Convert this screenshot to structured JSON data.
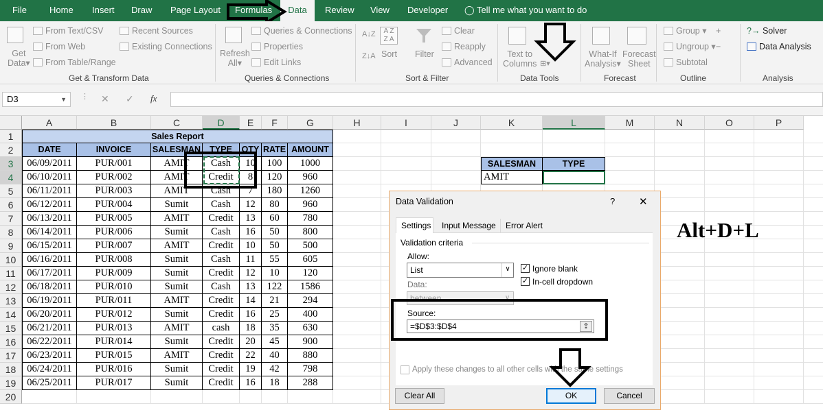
{
  "menu": {
    "tabs": [
      "File",
      "Home",
      "Insert",
      "Draw",
      "Page Layout",
      "Formulas",
      "Data",
      "Review",
      "View",
      "Developer"
    ],
    "active": "Data",
    "tell_me": "Tell me what you want to do"
  },
  "ribbon": {
    "get_data": [
      "Get",
      "Data"
    ],
    "from_text": "From Text/CSV",
    "from_web": "From Web",
    "from_table": "From Table/Range",
    "recent_sources": "Recent Sources",
    "existing_connections": "Existing Connections",
    "group_get_transform": "Get & Transform Data",
    "refresh_all": [
      "Refresh",
      "All"
    ],
    "queries_connections": "Queries & Connections",
    "properties": "Properties",
    "edit_links": "Edit Links",
    "group_queries": "Queries & Connections",
    "sort": "Sort",
    "filter": "Filter",
    "clear": "Clear",
    "reapply": "Reapply",
    "advanced": "Advanced",
    "group_sort_filter": "Sort & Filter",
    "text_to_columns": [
      "Text to",
      "Columns"
    ],
    "group_data_tools": "Data Tools",
    "what_if": [
      "What-If",
      "Analysis"
    ],
    "forecast_sheet": [
      "Forecast",
      "Sheet"
    ],
    "group_forecast": "Forecast",
    "group_btn": "Group",
    "ungroup": "Ungroup",
    "subtotal": "Subtotal",
    "group_outline": "Outline",
    "solver": "Solver",
    "data_analysis": "Data Analysis",
    "group_analysis": "Analysis"
  },
  "formula_bar": {
    "name_box": "D3",
    "fx": "fx",
    "cancel": "✕",
    "enter": "✓"
  },
  "sheet": {
    "columns": [
      "A",
      "B",
      "C",
      "D",
      "E",
      "F",
      "G",
      "H",
      "I",
      "J",
      "K",
      "L",
      "M",
      "N",
      "O",
      "P"
    ],
    "rows": [
      "1",
      "2",
      "3",
      "4",
      "5",
      "6",
      "7",
      "8",
      "9",
      "10",
      "11",
      "12",
      "13",
      "14",
      "15",
      "16",
      "17",
      "18",
      "19",
      "20"
    ],
    "title": "Sales Report",
    "headers": [
      "DATE",
      "INVOICE",
      "SALESMAN",
      "TYPE",
      "QTY",
      "RATE",
      "AMOUNT"
    ],
    "data": [
      [
        "06/09/2011",
        "PUR/001",
        "AMIT",
        "Cash",
        "10",
        "100",
        "1000"
      ],
      [
        "06/10/2011",
        "PUR/002",
        "AMIT",
        "Credit",
        "8",
        "120",
        "960"
      ],
      [
        "06/11/2011",
        "PUR/003",
        "AMIT",
        "Cash",
        "7",
        "180",
        "1260"
      ],
      [
        "06/12/2011",
        "PUR/004",
        "Sumit",
        "Cash",
        "12",
        "80",
        "960"
      ],
      [
        "06/13/2011",
        "PUR/005",
        "AMIT",
        "Credit",
        "13",
        "60",
        "780"
      ],
      [
        "06/14/2011",
        "PUR/006",
        "Sumit",
        "Cash",
        "16",
        "50",
        "800"
      ],
      [
        "06/15/2011",
        "PUR/007",
        "AMIT",
        "Credit",
        "10",
        "50",
        "500"
      ],
      [
        "06/16/2011",
        "PUR/008",
        "Sumit",
        "Cash",
        "11",
        "55",
        "605"
      ],
      [
        "06/17/2011",
        "PUR/009",
        "Sumit",
        "Credit",
        "12",
        "10",
        "120"
      ],
      [
        "06/18/2011",
        "PUR/010",
        "Sumit",
        "Cash",
        "13",
        "122",
        "1586"
      ],
      [
        "06/19/2011",
        "PUR/011",
        "AMIT",
        "Credit",
        "14",
        "21",
        "294"
      ],
      [
        "06/20/2011",
        "PUR/012",
        "Sumit",
        "Credit",
        "16",
        "25",
        "400"
      ],
      [
        "06/21/2011",
        "PUR/013",
        "AMIT",
        "cash",
        "18",
        "35",
        "630"
      ],
      [
        "06/22/2011",
        "PUR/014",
        "Sumit",
        "Credit",
        "20",
        "45",
        "900"
      ],
      [
        "06/23/2011",
        "PUR/015",
        "AMIT",
        "Credit",
        "22",
        "40",
        "880"
      ],
      [
        "06/24/2011",
        "PUR/016",
        "Sumit",
        "Credit",
        "19",
        "42",
        "798"
      ],
      [
        "06/25/2011",
        "PUR/017",
        "Sumit",
        "Credit",
        "16",
        "18",
        "288"
      ]
    ],
    "side_headers": [
      "SALESMAN",
      "TYPE"
    ],
    "side_values": [
      "AMIT",
      ""
    ]
  },
  "shortcut_text": "Alt+D+L",
  "dialog": {
    "title": "Data Validation",
    "help": "?",
    "close": "✕",
    "tabs": [
      "Settings",
      "Input Message",
      "Error Alert"
    ],
    "criteria_label": "Validation criteria",
    "allow_label": "Allow:",
    "allow_value": "List",
    "data_label": "Data:",
    "data_value": "between",
    "ignore_blank": "Ignore blank",
    "in_cell_dropdown": "In-cell dropdown",
    "source_label": "Source:",
    "source_value": "=$D$3:$D$4",
    "apply_all": "Apply these changes to all other cells with the same settings",
    "clear_all": "Clear All",
    "ok": "OK",
    "cancel": "Cancel"
  },
  "colors": {
    "excel_green": "#217346",
    "header_fill": "#a9c1e7",
    "title_fill": "#c4d5f0"
  }
}
